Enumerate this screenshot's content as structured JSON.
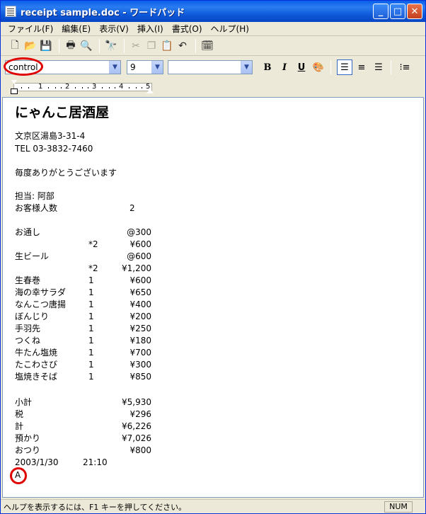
{
  "window": {
    "title": "receipt sample.doc - ワードパッド"
  },
  "menu": [
    "ファイル(F)",
    "編集(E)",
    "表示(V)",
    "挿入(I)",
    "書式(O)",
    "ヘルプ(H)"
  ],
  "format": {
    "font": "control",
    "size": "9",
    "script": ""
  },
  "ruler": [
    "1",
    "2",
    "3",
    "4",
    "5"
  ],
  "doc": {
    "shop": "にゃんこ居酒屋",
    "address": "文京区湯島3-31-4",
    "tel": "TEL  03-3832-7460",
    "thanks": "毎度ありがとうございます",
    "staff": "担当: 阿部",
    "guests_label": "お客様人数",
    "guests_value": "2",
    "items": [
      {
        "name": "お通し",
        "qty": "",
        "price": "@300"
      },
      {
        "name": "",
        "qty": "*2",
        "price": "¥600"
      },
      {
        "name": "生ビール",
        "qty": "",
        "price": "@600"
      },
      {
        "name": "",
        "qty": "*2",
        "price": "¥1,200"
      },
      {
        "name": "生春巻",
        "qty": "1",
        "price": "¥600"
      },
      {
        "name": "海の幸サラダ",
        "qty": "1",
        "price": "¥650"
      },
      {
        "name": "なんこつ唐揚",
        "qty": "1",
        "price": "¥400"
      },
      {
        "name": "ぼんじり",
        "qty": "1",
        "price": "¥200"
      },
      {
        "name": "手羽先",
        "qty": "1",
        "price": "¥250"
      },
      {
        "name": "つくね",
        "qty": "1",
        "price": "¥180"
      },
      {
        "name": "牛たん塩焼",
        "qty": "1",
        "price": "¥700"
      },
      {
        "name": "たこわさび",
        "qty": "1",
        "price": "¥300"
      },
      {
        "name": "塩焼きそば",
        "qty": "1",
        "price": "¥850"
      }
    ],
    "totals": [
      {
        "label": "小計",
        "value": "¥5,930"
      },
      {
        "label": "税",
        "value": "¥296"
      },
      {
        "label": "計",
        "value": "¥6,226"
      },
      {
        "label": "預かり",
        "value": "¥7,026"
      },
      {
        "label": "おつり",
        "value": "¥800"
      }
    ],
    "date": "2003/1/30",
    "time": "21:10",
    "cursor_text": "A"
  },
  "status": {
    "help": "ヘルプを表示するには、F1 キーを押してください。",
    "num": "NUM"
  },
  "accents": {
    "titlebar": "#0a5fea",
    "highlight": "#e00000"
  }
}
